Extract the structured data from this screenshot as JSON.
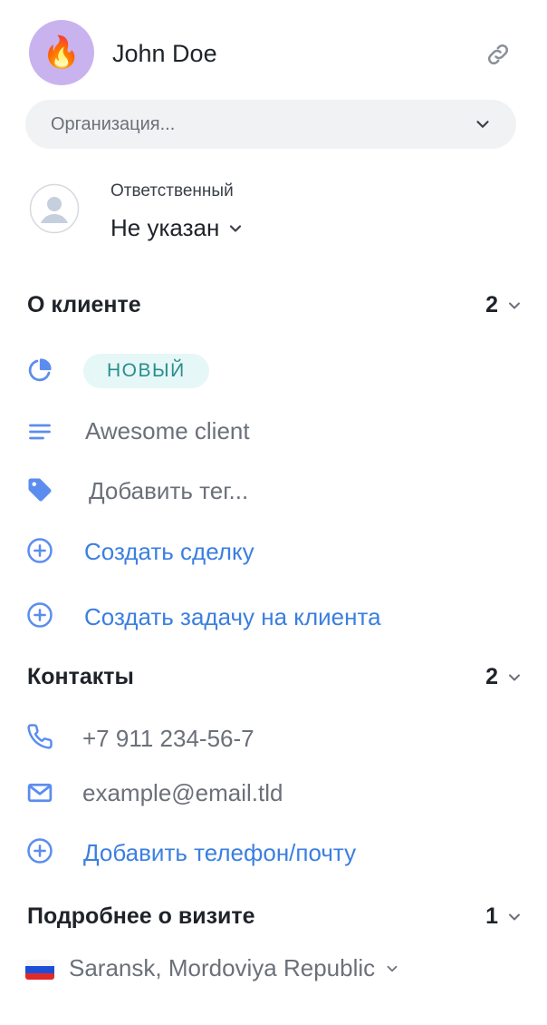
{
  "header": {
    "client_name": "John Doe",
    "avatar_emoji": "🔥",
    "avatar_color": "#c9b3ee"
  },
  "organization": {
    "placeholder": "Организация..."
  },
  "responsible": {
    "label": "Ответственный",
    "value": "Не указан"
  },
  "about": {
    "title": "О клиенте",
    "count": "2",
    "status_badge": "НОВЫЙ",
    "description": "Awesome client",
    "tag_placeholder": "Добавить тег...",
    "create_deal": "Создать сделку",
    "create_task": "Создать задачу на клиента"
  },
  "contacts": {
    "title": "Контакты",
    "count": "2",
    "phone": "+7 911 234-56-7",
    "email": "example@email.tld",
    "add_contact": "Добавить телефон/почту"
  },
  "visit": {
    "title": "Подробнее о визите",
    "count": "1",
    "location": "Saransk, Mordoviya Republic"
  },
  "colors": {
    "accent": "#3b7fe0",
    "icon": "#5b8def",
    "badge_bg": "#e6f7f7",
    "badge_text": "#2a8d8d"
  }
}
